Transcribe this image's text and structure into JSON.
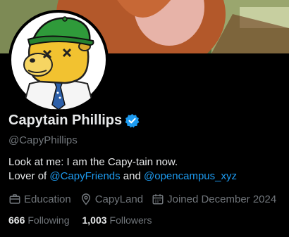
{
  "profile": {
    "display_name": "Capytain Phillips",
    "handle": "@CapyPhillips",
    "bio": {
      "line1": "Look at me: I am the Capy-tain now.",
      "line2_prefix": "Lover of ",
      "mention1": "@CapyFriends",
      "connector": " and ",
      "mention2": "@opencampus_xyz"
    },
    "meta": {
      "category": "Education",
      "location": "CapyLand",
      "joined": "Joined December 2024"
    },
    "following_count": "666",
    "following_label": "Following",
    "followers_count": "1,003",
    "followers_label": "Followers"
  },
  "colors": {
    "accent": "#1d9bf0",
    "text_primary": "#e7e9ea",
    "text_secondary": "#71767b",
    "background": "#000000"
  },
  "icons": [
    "verified-badge-icon",
    "briefcase-icon",
    "location-pin-icon",
    "calendar-icon"
  ]
}
